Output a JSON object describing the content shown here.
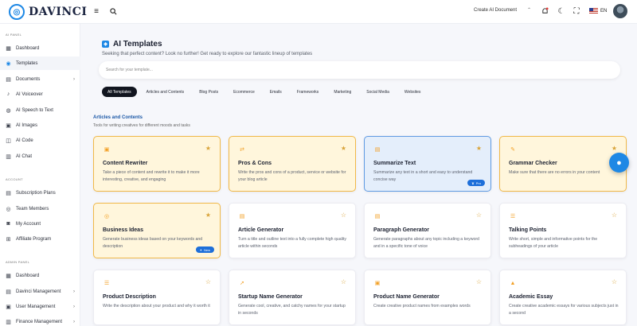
{
  "brand": {
    "name": "DAVINCI"
  },
  "topbar": {
    "create_document": "Create AI Document",
    "language": "EN"
  },
  "sidebar": {
    "sections": [
      {
        "label": "AI PANEL"
      },
      {
        "label": "ACCOUNT"
      },
      {
        "label": "ADMIN PANEL"
      }
    ],
    "items": [
      {
        "label": "Dashboard",
        "icon": "dashboard-icon"
      },
      {
        "label": "Templates",
        "icon": "templates-icon"
      },
      {
        "label": "Documents",
        "icon": "documents-icon"
      },
      {
        "label": "AI Voiceover",
        "icon": "voiceover-icon"
      },
      {
        "label": "AI Speech to Text",
        "icon": "speech-icon"
      },
      {
        "label": "AI Images",
        "icon": "images-icon"
      },
      {
        "label": "AI Code",
        "icon": "code-icon"
      },
      {
        "label": "AI Chat",
        "icon": "chat-icon"
      },
      {
        "label": "Subscription Plans",
        "icon": "subscription-icon"
      },
      {
        "label": "Team Members",
        "icon": "team-icon"
      },
      {
        "label": "My Account",
        "icon": "account-icon"
      },
      {
        "label": "Affiliate Program",
        "icon": "affiliate-icon"
      },
      {
        "label": "Dashboard",
        "icon": "dashboard-icon"
      },
      {
        "label": "Davinci Management",
        "icon": "management-icon"
      },
      {
        "label": "User Management",
        "icon": "users-icon"
      },
      {
        "label": "Finance Management",
        "icon": "finance-icon"
      }
    ]
  },
  "page": {
    "title": "AI Templates",
    "subtitle": "Seeking that perfect content? Look no further! Get ready to explore our fantastic lineup of templates",
    "search_placeholder": "Search for your template...",
    "tabs": [
      "All Templates",
      "Articles and Contents",
      "Blog Posts",
      "Ecommerce",
      "Emails",
      "Frameworks",
      "Marketing",
      "Social Media",
      "Websites"
    ],
    "section_title": "Articles and Contents",
    "section_subtitle": "Tools for writing creatives for different moods and tasks"
  },
  "cards": [
    {
      "title": "Content Rewriter",
      "desc": "Take a piece of content and rewrite it to make it more interesting, creative, and engaging",
      "style": "highlight",
      "badge": ""
    },
    {
      "title": "Pros & Cons",
      "desc": "Write the pros and cons of a product, service or website for your blog article",
      "style": "highlight",
      "badge": ""
    },
    {
      "title": "Summarize Text",
      "desc": "Summarize any text in a short and easy to understand concise way",
      "style": "selected",
      "badge": "Pro"
    },
    {
      "title": "Grammar Checker",
      "desc": "Make sure that there are no errors in your content",
      "style": "highlight",
      "badge": ""
    },
    {
      "title": "Business Ideas",
      "desc": "Generate business ideas based on your keywords and description",
      "style": "highlight",
      "badge": "New"
    },
    {
      "title": "Article Generator",
      "desc": "Turn a title and outline text into a fully complete high quality article within seconds",
      "style": "plain",
      "badge": ""
    },
    {
      "title": "Paragraph Generator",
      "desc": "Generate paragraphs about any topic including a keyword and in a specific tone of voice",
      "style": "plain",
      "badge": ""
    },
    {
      "title": "Talking Points",
      "desc": "Write short, simple and informative points for the subheadings of your article",
      "style": "plain",
      "badge": ""
    },
    {
      "title": "Product Description",
      "desc": "Write the description about your product and why it worth it",
      "style": "plain",
      "badge": ""
    },
    {
      "title": "Startup Name Generator",
      "desc": "Generate cool, creative, and catchy names for your startup in seconds",
      "style": "plain",
      "badge": ""
    },
    {
      "title": "Product Name Generator",
      "desc": "Create creative product names from examples words",
      "style": "plain",
      "badge": ""
    },
    {
      "title": "Academic Essay",
      "desc": "Create creative academic essays for various subjects just in a second",
      "style": "plain",
      "badge": ""
    }
  ]
}
